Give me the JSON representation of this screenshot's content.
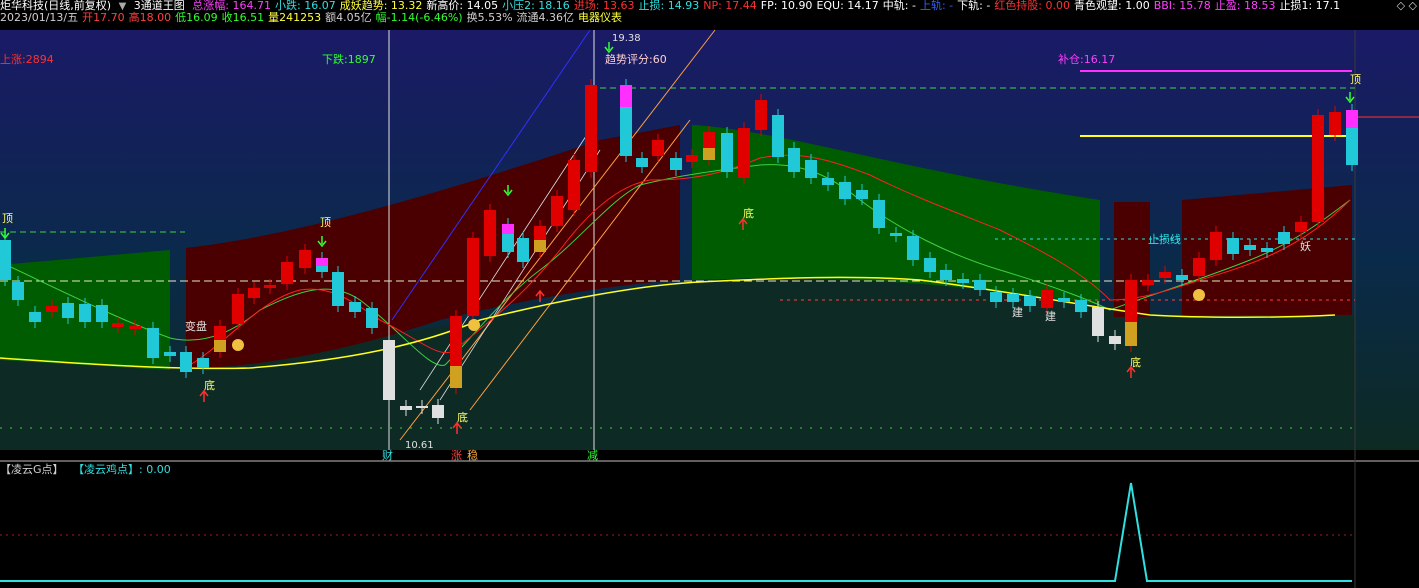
{
  "header": {
    "stock_name": "炬华科技(日线,前复权)",
    "menu_icon": "chevron-down-icon",
    "indicator_name": "3通道王图",
    "fields": [
      {
        "label": "总涨幅: 164.71",
        "color": "#ff40ff"
      },
      {
        "label": "小跌: 16.07",
        "color": "#30e0e0"
      },
      {
        "label": "成妖趋势: 13.32",
        "color": "#ffff40"
      },
      {
        "label": "新高价: 14.05",
        "color": "#ffffff"
      },
      {
        "label": "小压2: 18.16",
        "color": "#30e0e0"
      },
      {
        "label": "进场: 13.63",
        "color": "#ff3030"
      },
      {
        "label": "止损: 14.93",
        "color": "#30e0e0"
      },
      {
        "label": "NP: 17.44",
        "color": "#ff3030"
      },
      {
        "label": "FP: 10.90",
        "color": "#ffffff"
      },
      {
        "label": "EQU: 14.17",
        "color": "#ffffff"
      },
      {
        "label": "中轨: -",
        "color": "#ffffff"
      },
      {
        "label": "上轨: -",
        "color": "#3060ff"
      },
      {
        "label": "下轨: -",
        "color": "#ffffff"
      },
      {
        "label": "红色持股: 0.00",
        "color": "#ff3030"
      },
      {
        "label": "青色观望: 1.00",
        "color": "#ffffff"
      },
      {
        "label": "BBI: 15.78",
        "color": "#ff40ff"
      },
      {
        "label": "止盈: 18.53",
        "color": "#ff40ff"
      },
      {
        "label": "止损1: 17.1",
        "color": "#ffffff"
      }
    ],
    "corner_icons": "◇ ◇"
  },
  "info_bar": [
    {
      "label": "2023/01/13/五",
      "color": "#d0d0d0"
    },
    {
      "label": "开17.70",
      "color": "#ff4040"
    },
    {
      "label": "高18.00",
      "color": "#ff4040"
    },
    {
      "label": "低16.09",
      "color": "#30ff30"
    },
    {
      "label": "收16.51",
      "color": "#30ff30"
    },
    {
      "label": "量241253",
      "color": "#ffff40"
    },
    {
      "label": "额4.05亿",
      "color": "#d0d0d0"
    },
    {
      "label": "幅-1.14(-6.46%)",
      "color": "#30ff30"
    },
    {
      "label": "换5.53%",
      "color": "#d0d0d0"
    },
    {
      "label": "流通4.36亿",
      "color": "#d0d0d0"
    },
    {
      "label": "电器仪表",
      "color": "#ffff40"
    }
  ],
  "main_chart": {
    "labels": {
      "up_count": "上涨:2894",
      "down_count": "下跌:1897",
      "trend_score": "趋势评分:60",
      "add_position": "补仓:16.17",
      "stop_loss_line": "止损线",
      "high_price": "19.38",
      "low_price": "10.61",
      "biandan": "变盘",
      "peak": "顶",
      "bottom": "底",
      "yao": "妖",
      "jian": "建",
      "cai": "财",
      "zhang": "涨",
      "wen": "稳",
      "jian2": "减"
    },
    "colors": {
      "green_band": "#005c00",
      "red_band": "#4a0000",
      "up_candle": "#e00000",
      "down_candle": "#20c8d8",
      "ma_red": "#ff2020",
      "ma_green": "#40d040",
      "ma_yellow": "#ffff20"
    }
  },
  "sub_panel": {
    "title": "【凌云G点】",
    "indicator": "【凌云鸡点】: 0.00",
    "title_color": "#d0d0d0",
    "indicator_color": "#30e0e0"
  }
}
